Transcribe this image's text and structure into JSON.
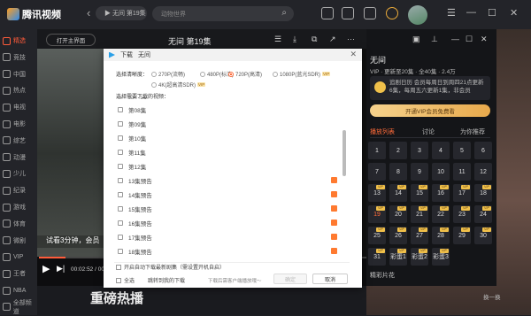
{
  "app": {
    "logo_text": "腾讯视频"
  },
  "topbar": {
    "history": "▶ 无间 第19集",
    "search_placeholder": "动物世界",
    "back_label": "‹",
    "forward_label": "›",
    "window_controls": [
      "☰",
      "—",
      "☐",
      "✕"
    ]
  },
  "sidebar": {
    "items": [
      {
        "label": "精选"
      },
      {
        "label": "竞技"
      },
      {
        "label": "中国"
      },
      {
        "label": "热点"
      },
      {
        "label": "电视"
      },
      {
        "label": "电影"
      },
      {
        "label": "综艺"
      },
      {
        "label": "动漫"
      },
      {
        "label": "少儿"
      },
      {
        "label": "纪录"
      },
      {
        "label": "游戏"
      },
      {
        "label": "体育"
      },
      {
        "label": "微剧"
      },
      {
        "label": "VIP"
      },
      {
        "label": "王者"
      },
      {
        "label": "NBA"
      },
      {
        "label": "全部频道"
      }
    ],
    "active_index": 0
  },
  "player": {
    "home_button": "打开主界面",
    "title": "无间 第19集",
    "subtitle_text": "试看3分钟，会员",
    "time": "00:02:52 / 00:03:00",
    "progress": 0.08,
    "play_icon": "▶",
    "next_icon": "▶|",
    "toolbar_icons": [
      "☰",
      "⤓",
      "⧉",
      "↗",
      "···"
    ]
  },
  "below": {
    "title": "重磅热播"
  },
  "dialog": {
    "header_prefix": "下载",
    "header_title": "无间",
    "close": "✕",
    "quality_label": "选择清晰度：",
    "quality_options": [
      {
        "label": "270P(流畅)",
        "selected": false,
        "vip": false
      },
      {
        "label": "480P(标清)",
        "selected": false,
        "vip": false
      },
      {
        "label": "720P(高清)",
        "selected": true,
        "vip": false
      },
      {
        "label": "1080P(蓝光SDR)",
        "selected": false,
        "vip": true
      },
      {
        "label": "4K(超高清SDR)",
        "selected": false,
        "vip": true
      }
    ],
    "vip_tag": "VIP",
    "list_label": "选择需要下载的视频：",
    "episodes": [
      {
        "label": "第07集",
        "preview": false
      },
      {
        "label": "第08集",
        "preview": false
      },
      {
        "label": "第09集",
        "preview": false
      },
      {
        "label": "第10集",
        "preview": false
      },
      {
        "label": "第11集",
        "preview": false
      },
      {
        "label": "第12集",
        "preview": false
      },
      {
        "label": "13集预告",
        "preview": true
      },
      {
        "label": "14集预告",
        "preview": true
      },
      {
        "label": "15集预告",
        "preview": true
      },
      {
        "label": "16集预告",
        "preview": true
      },
      {
        "label": "17集预告",
        "preview": true
      },
      {
        "label": "18集预告",
        "preview": true
      }
    ],
    "auto_download": "开启自动下载最新剧集（需设置开机自启）",
    "select_all": "全选",
    "goto_downloads": "跳转到我的下载",
    "hint": "下载后需客户端播放哦～",
    "confirm": "确定",
    "cancel": "取消"
  },
  "right_panel": {
    "title": "无间",
    "vip_line": "VIP · 更新至20集 · 全40集 · 2.4万",
    "notice_line1": "追剧日历 会员每周日到周四21点更新",
    "notice_line2": "6集，每周五六更新1集，非会员",
    "vip_button": "开通VIP会员免费看",
    "tabs": [
      "播放列表",
      "讨论",
      "为你推荐"
    ],
    "active_tab": 0,
    "episodes": [
      "1",
      "2",
      "3",
      "4",
      "5",
      "6",
      "7",
      "8",
      "9",
      "10",
      "11",
      "12",
      "13",
      "14",
      "15",
      "16",
      "17",
      "18",
      "19",
      "20",
      "21",
      "22",
      "23",
      "24",
      "25",
      "26",
      "27",
      "28",
      "29",
      "30",
      "31",
      "彩蛋1",
      "彩蛋2",
      "彩蛋3"
    ],
    "current_episode": "19",
    "vip_episodes": [
      "13",
      "14",
      "15",
      "16",
      "17",
      "18",
      "19",
      "20",
      "21",
      "22",
      "23",
      "24",
      "25",
      "26",
      "27",
      "28",
      "29",
      "30",
      "31",
      "彩蛋1",
      "彩蛋2",
      "彩蛋3"
    ],
    "footer_title": "精彩片花",
    "next_label": "换一换"
  }
}
